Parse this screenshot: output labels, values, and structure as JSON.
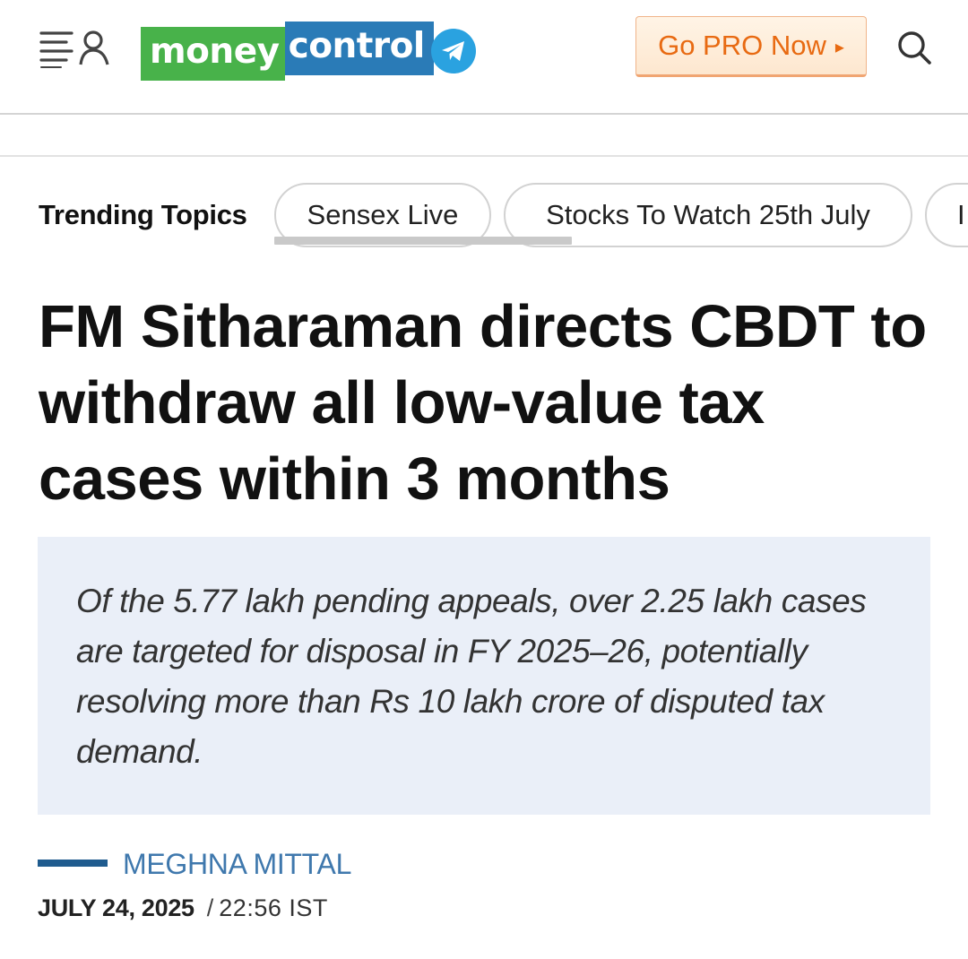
{
  "header": {
    "logo": {
      "part1": "money",
      "part2": "control"
    },
    "pro_button": {
      "label": "Go PRO Now",
      "caret": "▸"
    },
    "icons": [
      "menu-icon",
      "user-icon",
      "telegram-icon",
      "search-icon"
    ]
  },
  "trending": {
    "label": "Trending Topics",
    "chips": [
      "Sensex Live",
      "Stocks To Watch 25th July",
      "I"
    ]
  },
  "article": {
    "headline": "FM Sitharaman directs CBDT to withdraw all low-value tax cases within 3 months",
    "summary": "Of the 5.77 lakh pending appeals, over 2.25 lakh cases are targeted for disposal in FY 2025–26, potentially resolving more than Rs 10 lakh crore of disputed tax demand.",
    "author": "MEGHNA MITTAL",
    "date": "JULY 24, 2025",
    "separator": "/",
    "time": "22:56 IST"
  },
  "colors": {
    "logo_green": "#48b24a",
    "logo_blue": "#2a7bb7",
    "telegram_blue": "#2aa2e0",
    "pro_orange": "#e86a12",
    "summary_bg": "#eaeff8",
    "author_blue": "#3f78ad"
  }
}
